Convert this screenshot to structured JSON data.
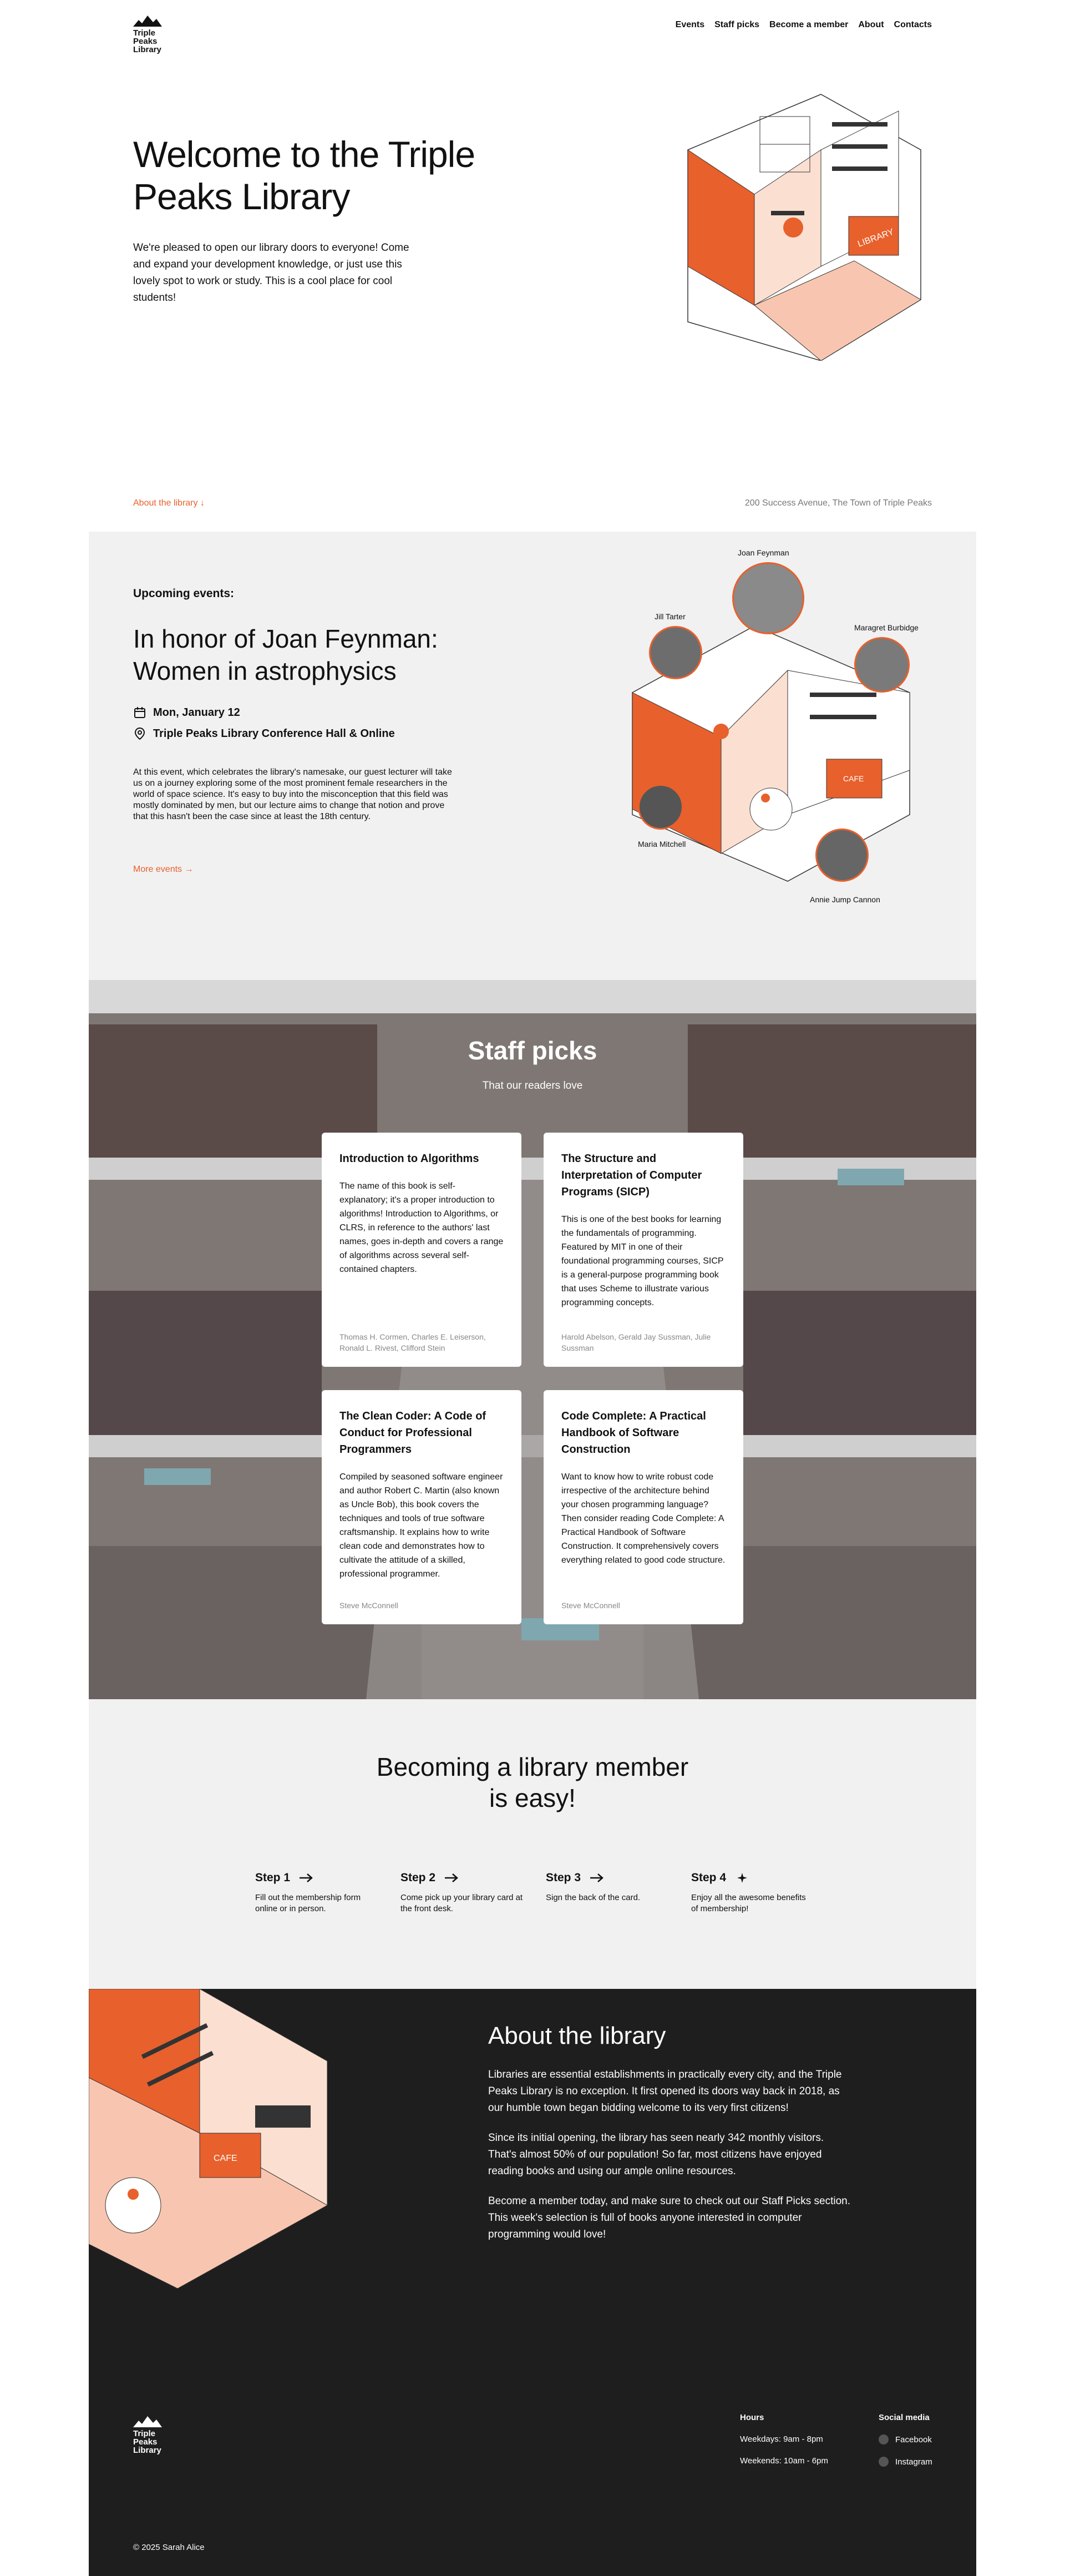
{
  "header": {
    "logo_text": "Triple\nPeaks\nLibrary",
    "nav": [
      "Events",
      "Staff picks",
      "Become a member",
      "About",
      "Contacts"
    ]
  },
  "hero": {
    "title": "Welcome to the Triple Peaks Library",
    "text": "We're pleased to open our library doors to everyone! Come and expand your development knowledge, or just use this lovely spot to work or study. This is a cool place for cool students!",
    "about_link": "About the library ↓",
    "address": "200 Success Avenue, The Town of Triple Peaks"
  },
  "events": {
    "label": "Upcoming events:",
    "title": "In honor of Joan Feynman: Women in astrophysics",
    "date": "Mon, January 12",
    "location": "Triple Peaks Library Conference Hall & Online",
    "description": "At this event, which celebrates the library's namesake, our guest lecturer will take us on a journey exploring some of the most prominent female researchers in the world of space science. It's easy to buy into the misconception that this field was mostly dominated by men, but our lecture aims to change that notion and prove that this hasn't been the case since at least the 18th century.",
    "more_link": "More events →",
    "people": [
      "Joan Feynman",
      "Jill Tarter",
      "Maragret Burbidge",
      "Maria Mitchell",
      "Annie Jump Cannon"
    ]
  },
  "staff": {
    "title": "Staff picks",
    "subtitle": "That our readers love",
    "cards": [
      {
        "title": "Introduction to Algorithms",
        "description": "The name of this book is self-explanatory; it's a proper introduction to algorithms! Introduction to Algorithms, or CLRS, in reference to the authors' last names, goes in-depth and covers a range of algorithms across several self-contained chapters.",
        "authors": "Thomas H. Cormen, Charles E. Leiserson, Ronald L. Rivest, Clifford Stein"
      },
      {
        "title": "The Structure and Interpretation of Computer Programs (SICP)",
        "description": "This is one of the best books for learning the fundamentals of programming. Featured by MIT in one of their foundational programming courses, SICP is a general-purpose programming book that uses Scheme to illustrate various programming concepts.",
        "authors": "Harold Abelson, Gerald Jay Sussman, Julie Sussman"
      },
      {
        "title": "The Clean Coder: A Code of Conduct for Professional Programmers",
        "description": "Compiled by seasoned software engineer and author Robert C. Martin (also known as Uncle Bob), this book covers the techniques and tools of true software craftsmanship. It explains how to write clean code and demonstrates how to cultivate the attitude of a skilled, professional programmer.",
        "authors": "Steve McConnell"
      },
      {
        "title": "Code Complete: A Practical Handbook of Software Construction",
        "description": "Want to know how to write robust code irrespective of the architecture behind your chosen programming language? Then consider reading Code Complete: A Practical Handbook of Software Construction. It comprehensively covers everything related to good code structure.",
        "authors": "Steve McConnell"
      }
    ]
  },
  "member": {
    "title": "Becoming a library member is easy!",
    "steps": [
      {
        "label": "Step 1",
        "text": "Fill out the membership form online or in person.",
        "icon": "arrow-right-icon"
      },
      {
        "label": "Step 2",
        "text": "Come pick up your library card at the front desk.",
        "icon": "arrow-right-icon"
      },
      {
        "label": "Step 3",
        "text": "Sign the back of the card.",
        "icon": "arrow-right-icon"
      },
      {
        "label": "Step 4",
        "text": "Enjoy all the awesome benefits of membership!",
        "icon": "sparkle-icon"
      }
    ]
  },
  "about": {
    "title": "About the library",
    "paragraphs": [
      "Libraries are essential establishments in practically every city, and the Triple Peaks Library is no exception. It first opened its doors way back in 2018, as our humble town began bidding welcome to its very first citizens!",
      "Since its initial opening, the library has seen nearly 342 monthly visitors. That's almost 50% of our population! So far, most citizens have enjoyed reading books and using our ample online resources.",
      "Become a member today, and make sure to check out our Staff Picks section. This week's selection is full of books anyone interested in computer programming would love!"
    ]
  },
  "footer": {
    "logo_text": "Triple\nPeaks\nLibrary",
    "hours_title": "Hours",
    "hours": [
      "Weekdays: 9am - 8pm",
      "Weekends: 10am - 6pm"
    ],
    "social_title": "Social media",
    "social": [
      "Facebook",
      "Instagram"
    ],
    "copyright": "© 2025 Sarah Alice"
  },
  "colors": {
    "accent": "#e8602c",
    "dark": "#1e1e1e",
    "light_bg": "#f1f1f1"
  }
}
